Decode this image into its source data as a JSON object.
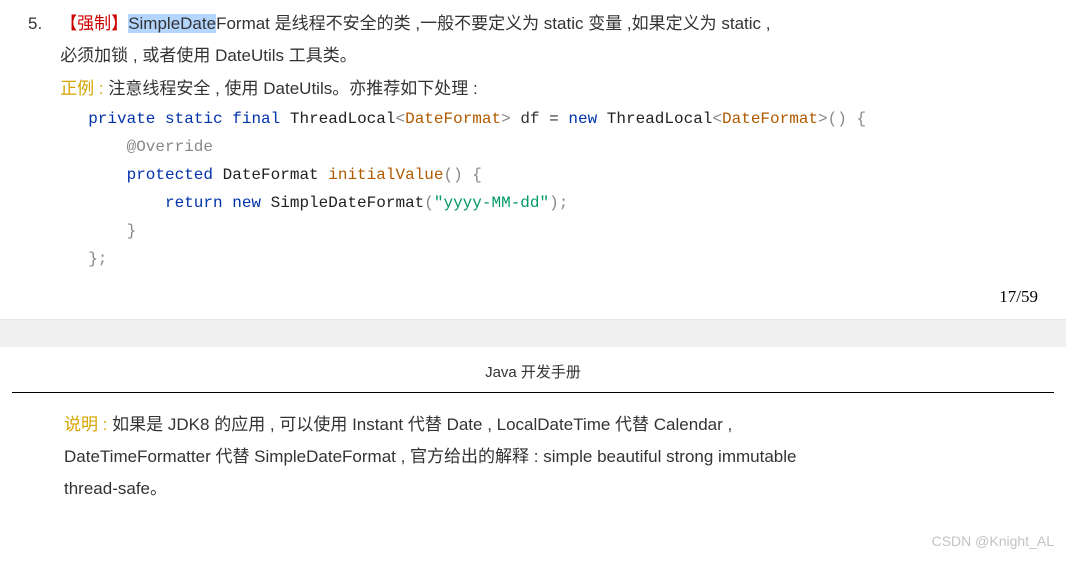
{
  "item": {
    "number": "5.",
    "tag": "【强制】",
    "highlight": "SimpleDate",
    "rest_word": "Format",
    "body1": "  是线程不安全的类 ,一般不要定义为 static 变量 ,如果定义为 static ,",
    "body2": "必须加锁 , 或者使用 DateUtils 工具类。",
    "example_label": "正例 :",
    "example_text": " 注意线程安全 , 使用 DateUtils。亦推荐如下处理 :"
  },
  "code": {
    "l1": {
      "kw1": "private",
      "kw2": "static",
      "kw3": "final",
      "typ": "ThreadLocal",
      "gen": "DateFormat",
      "var": "df",
      "eq": "=",
      "kw4": "new",
      "typ2": "ThreadLocal",
      "gen2": "DateFormat",
      "paren": "()",
      "brace": "{"
    },
    "l2": {
      "at": "@Override"
    },
    "l3": {
      "kw": "protected",
      "typ": "DateFormat",
      "fn": "initialValue",
      "paren": "()",
      "brace": "{"
    },
    "l4": {
      "kw": "return",
      "kw2": "new",
      "typ": "SimpleDateFormat",
      "paren_open": "(",
      "str": "\"yyyy-MM-dd\"",
      "paren_close": ");"
    },
    "l5": {
      "brace": "}"
    },
    "l6": {
      "brace": "};"
    }
  },
  "page_num": "17/59",
  "header": "Java 开发手册",
  "note": {
    "label": "说明 :",
    "line1": " 如果是 JDK8 的应用 , 可以使用 Instant 代替 Date , LocalDateTime 代替 Calendar ,",
    "line2": "DateTimeFormatter 代替 SimpleDateFormat , 官方给出的解释 : simple beautiful strong immutable",
    "line3": "thread-safe。"
  },
  "watermark": "CSDN @Knight_AL"
}
